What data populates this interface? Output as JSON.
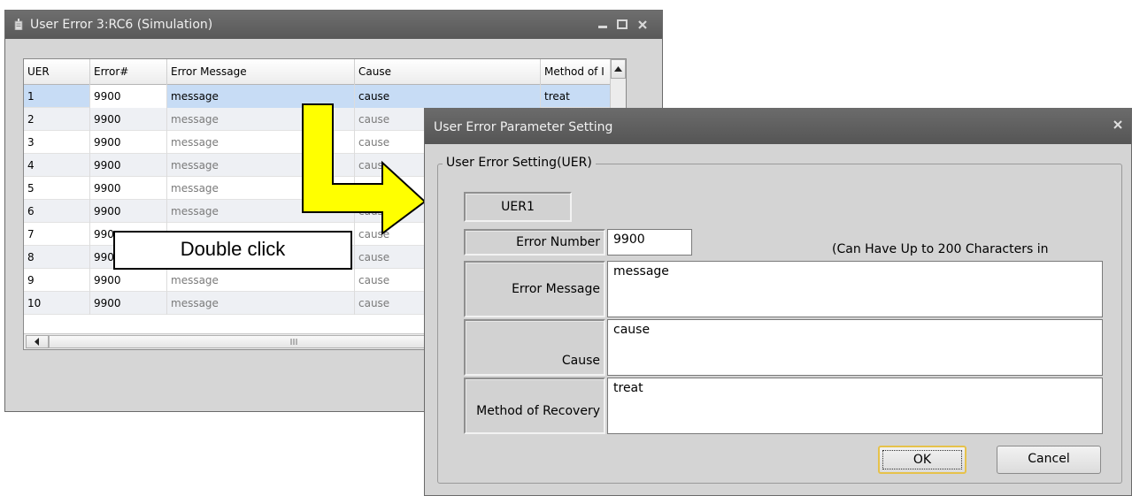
{
  "list_window": {
    "title": "User Error 3:RC6  (Simulation)",
    "columns": [
      "UER",
      "Error#",
      "Error Message",
      "Cause",
      "Method of I"
    ],
    "rows": [
      {
        "uer": "1",
        "err": "9900",
        "msg": "message",
        "cause": "cause",
        "method": "treat"
      },
      {
        "uer": "2",
        "err": "9900",
        "msg": "message",
        "cause": "cause",
        "method": ""
      },
      {
        "uer": "3",
        "err": "9900",
        "msg": "message",
        "cause": "cause",
        "method": ""
      },
      {
        "uer": "4",
        "err": "9900",
        "msg": "message",
        "cause": "caus",
        "method": ""
      },
      {
        "uer": "5",
        "err": "9900",
        "msg": "message",
        "cause": "",
        "method": ""
      },
      {
        "uer": "6",
        "err": "9900",
        "msg": "message",
        "cause": "caus",
        "method": ""
      },
      {
        "uer": "7",
        "err": "990",
        "msg": "",
        "cause": "cause",
        "method": ""
      },
      {
        "uer": "8",
        "err": "990",
        "msg": "",
        "cause": "cause",
        "method": ""
      },
      {
        "uer": "9",
        "err": "9900",
        "msg": "message",
        "cause": "cause",
        "method": ""
      },
      {
        "uer": "10",
        "err": "9900",
        "msg": "message",
        "cause": "cause",
        "method": ""
      }
    ],
    "selected_row": 1
  },
  "callout": {
    "text": "Double click",
    "arrow_color": "#ffff00"
  },
  "dialog": {
    "title": "User Error Parameter Setting",
    "group_title": "User Error Setting(UER)",
    "uer_label": "UER1",
    "error_number_label": "Error Number",
    "error_number_value": "9900",
    "hint": "(Can Have Up to 200 Characters in",
    "error_message_label": "Error Message",
    "error_message_value": "message",
    "cause_label": "Cause",
    "cause_value": "cause",
    "method_label": "Method of Recovery",
    "method_value": "treat",
    "ok_label": "OK",
    "cancel_label": "Cancel"
  },
  "colors": {
    "titlebar": "#5f5f5f",
    "selection": "#c7dcf5",
    "ok_border": "#e6c24b"
  }
}
